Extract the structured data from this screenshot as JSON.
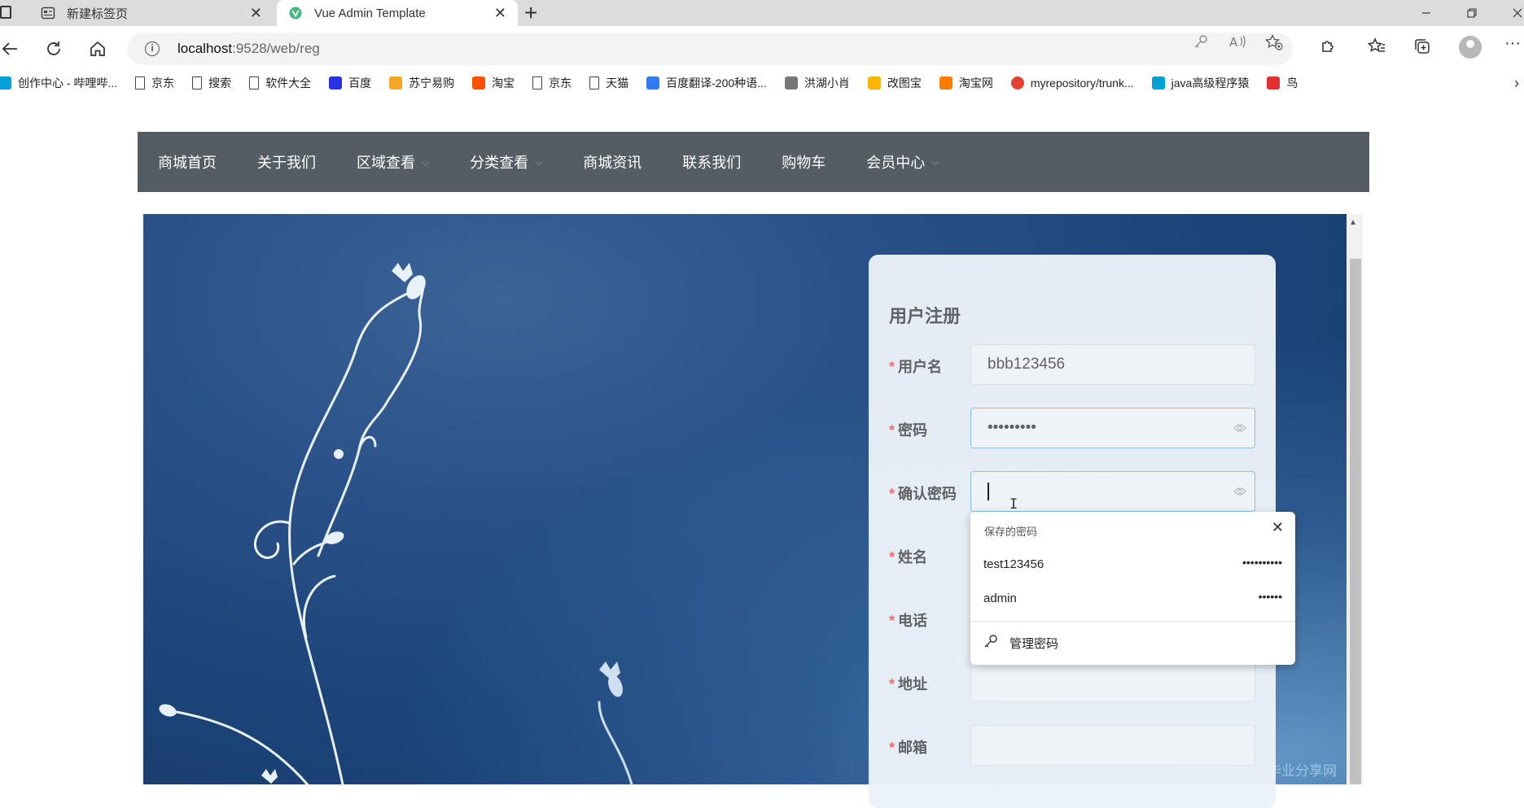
{
  "browser": {
    "tabs": [
      {
        "title": "新建标签页",
        "active": false
      },
      {
        "title": "Vue Admin Template",
        "active": true
      }
    ],
    "url_host": "localhost",
    "url_path": ":9528/web/reg",
    "bookmarks": [
      {
        "label": "创作中心 - 哔哩哔...",
        "icon": "bilibili-icon",
        "color": "#00a1d6"
      },
      {
        "label": "京东",
        "icon": "page-icon"
      },
      {
        "label": "搜索",
        "icon": "page-icon"
      },
      {
        "label": "软件大全",
        "icon": "page-icon"
      },
      {
        "label": "百度",
        "icon": "baidu-paw-icon",
        "color": "#2932e1"
      },
      {
        "label": "苏宁易购",
        "icon": "suning-icon",
        "color": "#f5a623"
      },
      {
        "label": "淘宝",
        "icon": "taobao-icon",
        "color": "#ff5000"
      },
      {
        "label": "京东",
        "icon": "page-icon"
      },
      {
        "label": "天猫",
        "icon": "page-icon"
      },
      {
        "label": "百度翻译-200种语...",
        "icon": "translate-icon",
        "color": "#2f7bf6"
      },
      {
        "label": "洪湖小肖",
        "icon": "bird-icon",
        "color": "#777777"
      },
      {
        "label": "改图宝",
        "icon": "gaitubao-icon",
        "color": "#ffb400"
      },
      {
        "label": "淘宝网",
        "icon": "taobao-icon",
        "color": "#ff7a00"
      },
      {
        "label": "myrepository/trunk...",
        "icon": "chrome-icon",
        "color": "#e34133"
      },
      {
        "label": "java高级程序猿",
        "icon": "bilibili-icon",
        "color": "#00a1d6"
      },
      {
        "label": "鸟",
        "icon": "bird-red-icon",
        "color": "#e0302f"
      }
    ]
  },
  "nav": {
    "items": [
      {
        "label": "商城首页",
        "dropdown": false
      },
      {
        "label": "关于我们",
        "dropdown": false
      },
      {
        "label": "区域查看",
        "dropdown": true
      },
      {
        "label": "分类查看",
        "dropdown": true
      },
      {
        "label": "商城资讯",
        "dropdown": false
      },
      {
        "label": "联系我们",
        "dropdown": false
      },
      {
        "label": "购物车",
        "dropdown": false
      },
      {
        "label": "会员中心",
        "dropdown": true
      }
    ]
  },
  "form": {
    "title": "用户注册",
    "required_mark": "*",
    "fields": [
      {
        "label": "用户名",
        "value": "bbb123456"
      },
      {
        "label": "密码",
        "value": "•••••••••"
      },
      {
        "label": "确认密码",
        "value": ""
      },
      {
        "label": "姓名",
        "value": ""
      },
      {
        "label": "电话",
        "value": ""
      },
      {
        "label": "地址",
        "value": ""
      },
      {
        "label": "邮箱",
        "value": ""
      }
    ]
  },
  "password_popup": {
    "heading": "保存的密码",
    "entries": [
      {
        "username": "test123456",
        "mask": "••••••••••"
      },
      {
        "username": "admin",
        "mask": "••••••"
      }
    ],
    "manage_label": "管理密码"
  },
  "watermark": "CSDN @程序猿毕业分享网",
  "colors": {
    "nav_bg": "#545c64",
    "required": "#f56c6c",
    "label": "#606266"
  }
}
